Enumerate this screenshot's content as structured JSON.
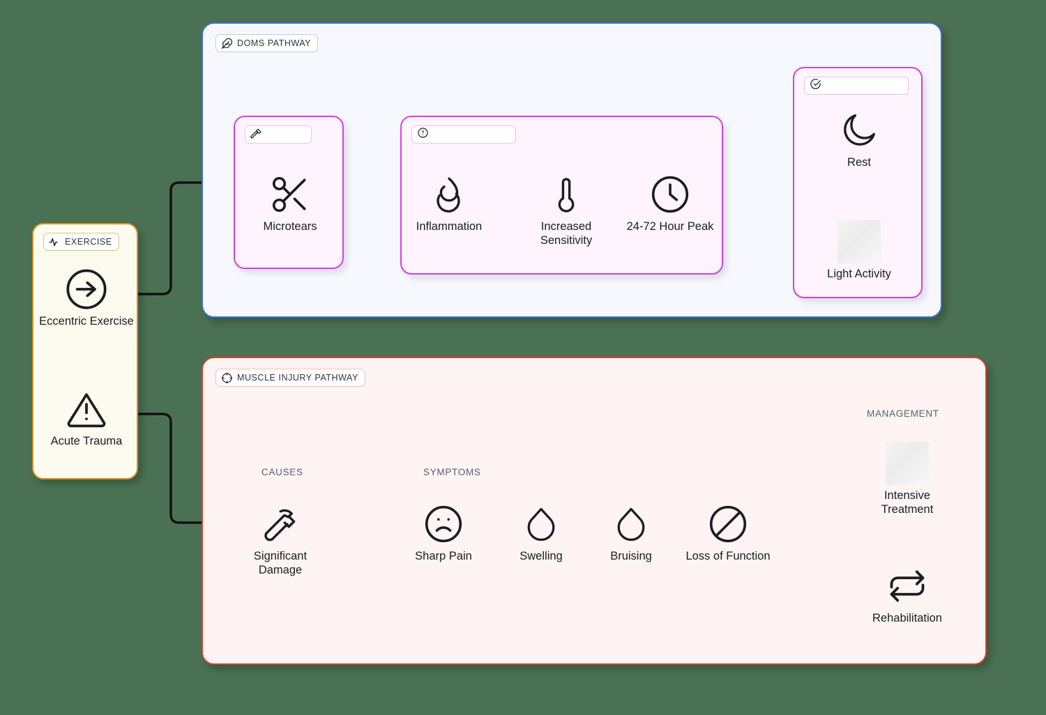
{
  "background_color": "#4a7153",
  "panels": {
    "exercise": {
      "tag_label": "EXERCISE",
      "tag_icon": "activity-pulse-icon",
      "border_color": "#d9901f",
      "fill_color": "#fdfbef",
      "nodes": [
        {
          "label": "Eccentric Exercise",
          "icon": "arrow-right-circle-icon"
        },
        {
          "label": "Acute Trauma",
          "icon": "alert-triangle-icon"
        }
      ]
    },
    "doms": {
      "tag_label": "DOMS PATHWAY",
      "tag_icon": "feather-icon",
      "border_color": "#3b6fd4",
      "fill_color": "#f6f8fe",
      "groups": [
        {
          "tag_label": "",
          "tag_icon": "wrench-icon",
          "accent": "#d93fe0"
        },
        {
          "tag_label": "",
          "tag_icon": "alert-circle-icon",
          "accent": "#d93fe0"
        },
        {
          "tag_label": "",
          "tag_icon": "check-circle-icon",
          "accent": "#d93fe0"
        }
      ],
      "nodes": [
        {
          "label": "Microtears",
          "icon": "scissors-icon"
        },
        {
          "label": "Inflammation",
          "icon": "flame-icon"
        },
        {
          "label": "Increased Sensitivity",
          "icon": "thermometer-icon"
        },
        {
          "label": "24-72 Hour Peak",
          "icon": "clock-icon"
        },
        {
          "label": "Rest",
          "icon": "moon-icon"
        },
        {
          "label": "Light Activity",
          "icon": "missing-image-icon"
        }
      ]
    },
    "injury": {
      "tag_label": "MUSCLE INJURY PATHWAY",
      "tag_icon": "crosshair-icon",
      "border_color": "#d9402f",
      "fill_color": "#fdf4f3",
      "section_labels": [
        "CAUSES",
        "SYMPTOMS",
        "MANAGEMENT"
      ],
      "nodes": [
        {
          "label": "Significant Damage",
          "icon": "hammer-icon"
        },
        {
          "label": "Sharp Pain",
          "icon": "frown-face-icon"
        },
        {
          "label": "Swelling",
          "icon": "droplet-icon"
        },
        {
          "label": "Bruising",
          "icon": "droplet-icon"
        },
        {
          "label": "Loss of Function",
          "icon": "ban-slash-circle-icon"
        },
        {
          "label": "Intensive Treatment",
          "icon": "missing-image-icon"
        },
        {
          "label": "Rehabilitation",
          "icon": "refresh-cycle-icon"
        }
      ]
    }
  }
}
